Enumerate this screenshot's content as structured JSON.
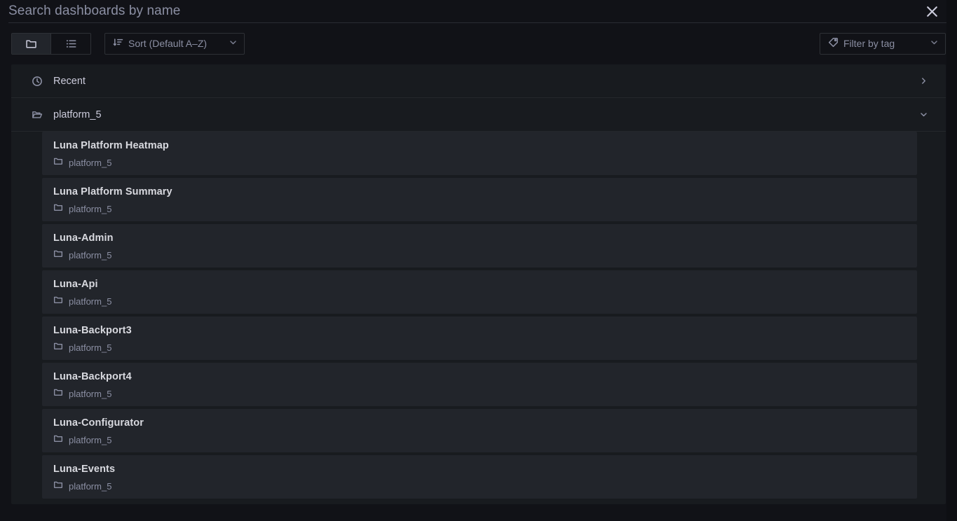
{
  "search": {
    "placeholder": "Search dashboards by name",
    "value": "",
    "close_label": "Close search"
  },
  "toolbar": {
    "view_toggle": [
      {
        "name": "folder-view",
        "icon": "folder-icon",
        "active": true
      },
      {
        "name": "list-view",
        "icon": "list-icon",
        "active": false
      }
    ],
    "sort": {
      "label": "Sort (Default A–Z)",
      "icon": "sort-amount-down-icon",
      "caret": "chevron-down-icon"
    },
    "tag_filter": {
      "label": "Filter by tag",
      "icon": "tag-icon",
      "caret": "chevron-down-icon"
    }
  },
  "sections": [
    {
      "label": "Recent",
      "icon": "clock-icon",
      "expanded": false,
      "caret": "chevron-right-icon",
      "items": []
    },
    {
      "label": "platform_5",
      "icon": "folder-open-icon",
      "expanded": true,
      "caret": "chevron-down-icon",
      "items": [
        {
          "title": "Luna Platform Heatmap",
          "folder": "platform_5"
        },
        {
          "title": "Luna Platform Summary",
          "folder": "platform_5"
        },
        {
          "title": "Luna-Admin",
          "folder": "platform_5"
        },
        {
          "title": "Luna-Api",
          "folder": "platform_5"
        },
        {
          "title": "Luna-Backport3",
          "folder": "platform_5"
        },
        {
          "title": "Luna-Backport4",
          "folder": "platform_5"
        },
        {
          "title": "Luna-Configurator",
          "folder": "platform_5"
        },
        {
          "title": "Luna-Events",
          "folder": "platform_5"
        }
      ]
    }
  ],
  "colors": {
    "page_bg": "#111217",
    "panel_bg": "#181b1f",
    "card_bg": "#22252b",
    "text_primary": "#ccccdc",
    "text_secondary": "#8b8fa3",
    "border": "#2e3136"
  }
}
